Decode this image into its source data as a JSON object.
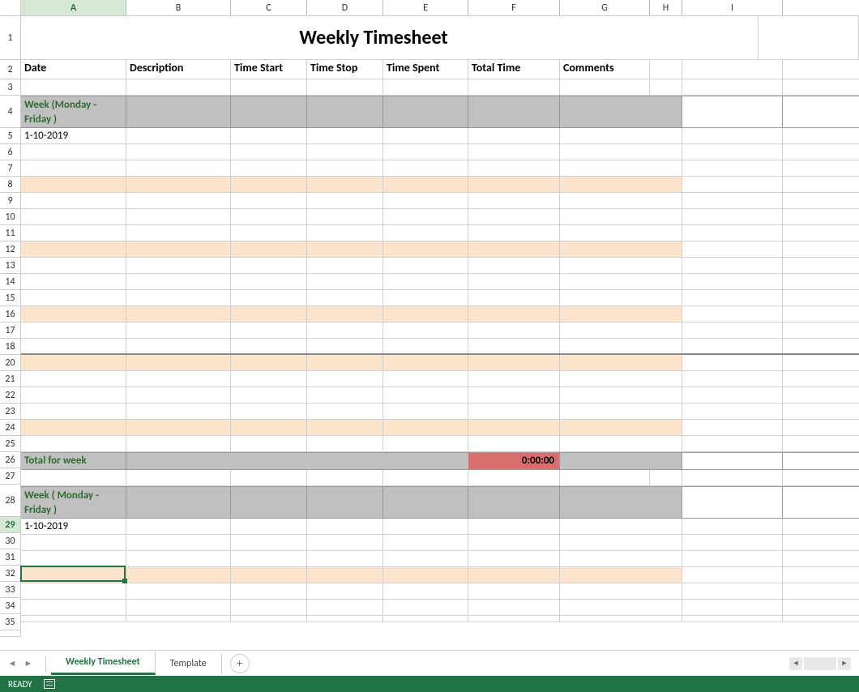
{
  "columns": [
    "A",
    "B",
    "C",
    "D",
    "E",
    "F",
    "G",
    "H",
    "I"
  ],
  "title": "Weekly Timesheet",
  "headers": {
    "date": "Date",
    "description": "Description",
    "time_start": "Time Start",
    "time_stop": "Time Stop",
    "time_spent": "Time Spent",
    "total_time": "Total Time",
    "comments": "Comments"
  },
  "week1": {
    "label": "Week  (Monday - Friday )",
    "date": "1-10-2019",
    "total_label": "Total for week",
    "total_value": "0:00:00"
  },
  "week2": {
    "label": "Week ( Monday - Friday )",
    "date": "1-10-2019"
  },
  "row_numbers": [
    "1",
    "2",
    "3",
    "4",
    "5",
    "6",
    "7",
    "8",
    "9",
    "10",
    "11",
    "12",
    "13",
    "14",
    "15",
    "16",
    "17",
    "18",
    "20",
    "21",
    "22",
    "23",
    "24",
    "25",
    "26",
    "27",
    "28",
    "29",
    "30",
    "31",
    "32",
    "33",
    "34",
    "35"
  ],
  "selected_row_index": 28,
  "tabs": {
    "active": "Weekly Timesheet",
    "other": "Template"
  },
  "status": "READY"
}
